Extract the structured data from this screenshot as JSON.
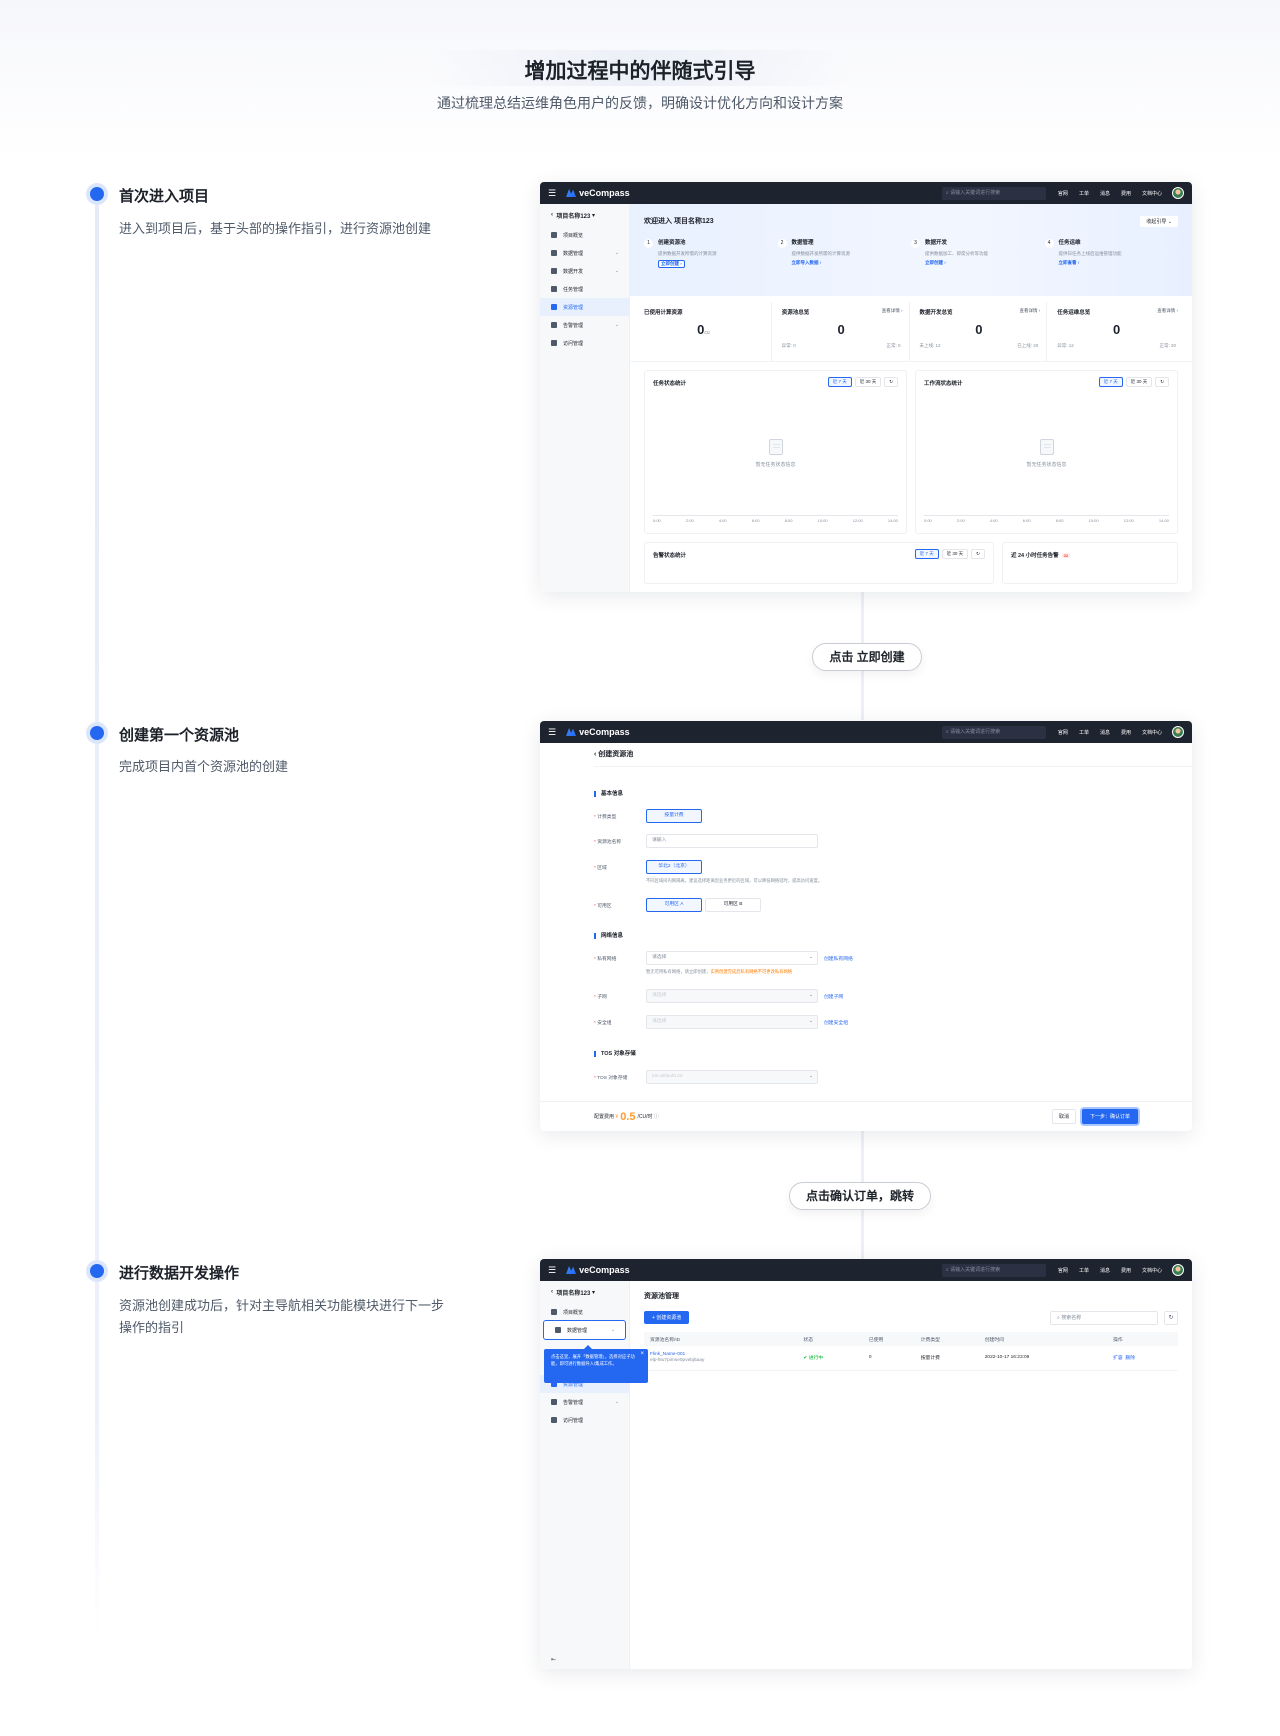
{
  "page": {
    "title": "增加过程中的伴随式引导",
    "subtitle": "通过梳理总结运维角色用户的反馈，明确设计优化方向和设计方案"
  },
  "steps": [
    {
      "title": "首次进入项目",
      "desc": "进入到项目后，基于头部的操作指引，进行资源池创建"
    },
    {
      "title": "创建第一个资源池",
      "desc": "完成项目内首个资源池的创建"
    },
    {
      "title": "进行数据开发操作",
      "desc": "资源池创建成功后，针对主导航相关功能模块进行下一步操作的指引"
    }
  ],
  "pills": [
    "点击 立即创建",
    "点击确认订单，跳转"
  ],
  "app": {
    "brand": "veCompass",
    "search_placeholder": "请输入关键词进行搜索",
    "nav": [
      "官网",
      "工单",
      "消息",
      "费用",
      "文档中心"
    ],
    "project": "项目名称123",
    "sidebar": [
      {
        "label": "项目概览",
        "icon": "overview-icon",
        "chev": false
      },
      {
        "label": "数据管理",
        "icon": "database-icon",
        "chev": true
      },
      {
        "label": "数据开发",
        "icon": "code-icon",
        "chev": true
      },
      {
        "label": "任务管理",
        "icon": "task-icon",
        "chev": false
      },
      {
        "label": "资源管理",
        "icon": "layers-icon",
        "chev": false
      },
      {
        "label": "告警管理",
        "icon": "bell-icon",
        "chev": true
      },
      {
        "label": "访问管理",
        "icon": "shield-icon",
        "chev": false
      }
    ],
    "colors": {
      "primary": "#2468f2",
      "topbar": "#1e2330",
      "accent_price": "#ff9a2e",
      "success": "#00b42a"
    }
  },
  "shot1": {
    "welcome": "欢迎进入 项目名称123",
    "collapse": "收起引导",
    "guide": [
      {
        "num": "1",
        "name": "创建资源池",
        "desc": "提供数据开发所需的计算资源",
        "link": "立即创建 ›"
      },
      {
        "num": "2",
        "name": "数据管理",
        "desc": "提供数据开发所需的计算资源",
        "link": "立即导入数据 ›"
      },
      {
        "num": "3",
        "name": "数据开发",
        "desc": "提供数据加工、即席分析等功能",
        "link": "立即创建 ›"
      },
      {
        "num": "4",
        "name": "任务运维",
        "desc": "提供日任务上线后运维管理功能",
        "link": "立即查看 ›"
      }
    ],
    "stats": [
      {
        "name": "已使用计算资源",
        "value": "0",
        "unit": "cu",
        "link": "",
        "f1": "",
        "f2": ""
      },
      {
        "name": "资源池总览",
        "value": "0",
        "unit": "",
        "link": "查看详情 ›",
        "f1": "异常: 0",
        "f2": "正常: 0"
      },
      {
        "name": "数据开发总览",
        "value": "0",
        "unit": "",
        "link": "查看详情 ›",
        "f1": "未上线: 12",
        "f2": "已上线: 20"
      },
      {
        "name": "任务运维总览",
        "value": "0",
        "unit": "",
        "link": "查看详情 ›",
        "f1": "异常: 12",
        "f2": "正常: 20"
      }
    ],
    "charts": [
      {
        "title": "任务状态统计",
        "empty": "暂无任务状态信息"
      },
      {
        "title": "工作流状态统计",
        "empty": "暂无任务状态信息"
      }
    ],
    "range7": "近 7 天",
    "range30": "近 30 天",
    "ticks": [
      "0:00",
      "2:00",
      "4:00",
      "6:00",
      "8:00",
      "10:00",
      "12:00",
      "14:00"
    ],
    "alarm_title": "告警状态统计",
    "task24_title": "近 24 小时任务告警",
    "task24_badge": "32"
  },
  "shot2": {
    "header": "‹ 创建资源池",
    "sec_basic": "基本信息",
    "billing_label": "计费类型",
    "billing_value": "按量计费",
    "name_label": "资源池名称",
    "name_placeholder": "请输入",
    "region_label": "区域",
    "region_value": "华北2（北京）",
    "region_hint": "不同区域间内网隔离，建议选择距离您业务更近的区域，可以降低网络延时，提高访问速度。",
    "zone_label": "可用区",
    "zone_a": "可用区 A",
    "zone_b": "可用区 B",
    "sec_network": "网络信息",
    "vpc_label": "私有网络",
    "vpc_placeholder": "请选择",
    "vpc_link": "创建私有网络",
    "vpc_hint_a": "暂无可用私有网络，请立即创建，",
    "vpc_hint_b": "实例创建完成后私有网络不可更改私有网络",
    "subnet_label": "子网",
    "subnet_placeholder": "请选择",
    "subnet_link": "创建子网",
    "sg_label": "安全组",
    "sg_placeholder": "请选择",
    "sg_link": "创建安全组",
    "sec_tos": "TOS 对象存储",
    "tos_label": "TOS 对象存储",
    "tos_value": "tos-default123",
    "fee_label": "配置费用",
    "fee_currency": "¥",
    "fee_value": "0.5",
    "fee_unit": "/CU/时",
    "cancel": "取消",
    "next": "下一步：确认订单"
  },
  "shot3": {
    "title": "资源池管理",
    "create_btn": "+ 创建资源池",
    "search_placeholder": "搜索名称",
    "tip_text": "点击这里，展开「数据管理」，选择对应子功能，即可进行数据导入/集成工作。",
    "columns": [
      "资源池名称/ID",
      "状态",
      "已使用",
      "计费类型",
      "创建时间",
      "操作"
    ],
    "rows": [
      {
        "name": "Flink_Name-001",
        "id": "elp-l8u7pimse0pvebj5aay",
        "status": "进行中",
        "used": "0",
        "billing": "按量计费",
        "created": "2022-10-17 16:23:09",
        "op1": "扩容",
        "op2": "删除"
      }
    ]
  }
}
